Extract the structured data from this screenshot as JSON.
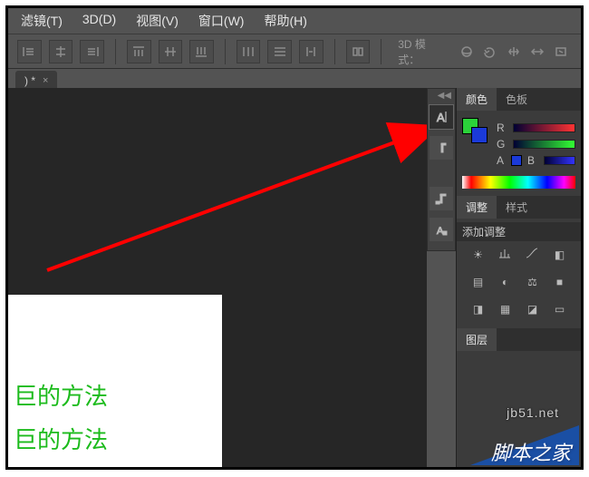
{
  "menu": {
    "filter": "滤镜(T)",
    "threeD": "3D(D)",
    "view": "视图(V)",
    "window": "窗口(W)",
    "help": "帮助(H)"
  },
  "optionsbar": {
    "mode3d_label": "3D 模式："
  },
  "tab": {
    "label": ") *",
    "close": "×"
  },
  "right": {
    "tabs": {
      "color": "颜色",
      "swatches": "色板"
    },
    "channels": {
      "r": "R",
      "g": "G",
      "b": "B"
    },
    "text_a": "A",
    "tabs2": {
      "adjust": "调整",
      "styles": "样式"
    },
    "add_adjust": "添加调整",
    "tabs3": {
      "layers": "图层"
    }
  },
  "colors": {
    "fg": "#2bd23a",
    "bg": "#1b3ad8"
  },
  "canvas_text": {
    "line1": "巨的方法",
    "line2": "巨的方法"
  },
  "watermark_url": "jb51.net",
  "footer_text": "脚本之家"
}
